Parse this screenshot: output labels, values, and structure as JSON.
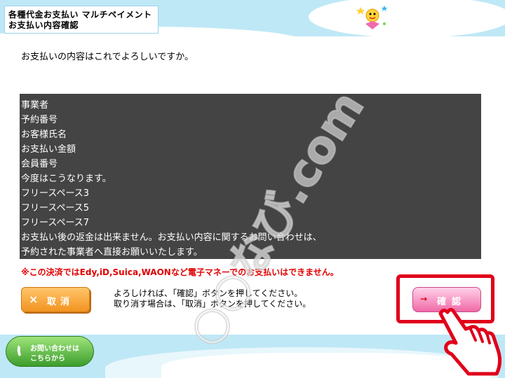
{
  "header": {
    "title_line1": "各種代金お支払い マルチペイメント",
    "title_line2": "お支払い内容確認",
    "mascot_icon": "mascot-icon"
  },
  "main": {
    "question": "お支払いの内容はこれでよろしいですか。",
    "details": [
      "事業者",
      "予約番号",
      "お客様氏名",
      "お支払い金額",
      "会員番号",
      "今度はこうなります。",
      "フリースペース3",
      "フリースペース5",
      "フリースペース7",
      "お支払い後の返金は出来ません。お支払い内容に関するお問い合わせは、",
      "予約された事業者へ直接お願いいたします。"
    ],
    "warning": "※この決済ではEdy,iD,Suica,WAONなど電子マネーでのお支払いはできません。",
    "instruction_line1": "よろしければ、「確認」ボタンを押してください。",
    "instruction_line2": "取り消す場合は、「取消」ボタンを押してください。"
  },
  "buttons": {
    "cancel_icon": "×",
    "cancel_label": "取消",
    "confirm_icon": "→",
    "confirm_label": "確認",
    "contact_line1": "お問い合わせは",
    "contact_line2": "こちらから"
  },
  "watermark": "○○なび.com",
  "colors": {
    "panel_bg": "#444444",
    "warning": "#e10000",
    "highlight_frame": "#e0001b",
    "header_bg": "#bfe8f6"
  }
}
